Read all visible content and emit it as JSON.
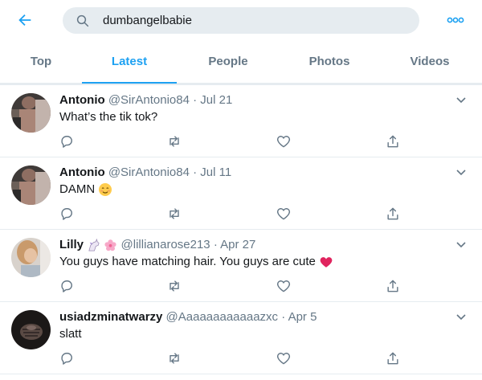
{
  "header": {
    "back_icon": "arrow-left-icon",
    "search_icon": "search-icon",
    "search_value": "dumbangelbabie",
    "more_icon": "more-horizontal-icon",
    "accent_color": "#1da1f2"
  },
  "tabs": [
    {
      "label": "Top",
      "active": false
    },
    {
      "label": "Latest",
      "active": true
    },
    {
      "label": "People",
      "active": false
    },
    {
      "label": "Photos",
      "active": false
    },
    {
      "label": "Videos",
      "active": false
    }
  ],
  "tweets": [
    {
      "name": "Antonio",
      "handle": "@SirAntonio84",
      "date": "Jul 21",
      "text": "What’s the tik tok?"
    },
    {
      "name": "Antonio",
      "handle": "@SirAntonio84",
      "date": "Jul 11",
      "text": "DAMN",
      "trailing_emoji": "smiling-blushing-face"
    },
    {
      "name": "Lilly",
      "name_emojis": [
        "unicorn",
        "cherry-blossom"
      ],
      "handle": "@lillianarose213",
      "date": "Apr 27",
      "text": "You guys have matching hair. You guys are cute",
      "trailing_emoji": "red-heart"
    },
    {
      "name": "usiadzminatwarzy",
      "handle": "@Aaaaaaaaaaaazxc",
      "date": "Apr 5",
      "text": "slatt"
    }
  ],
  "actions": {
    "reply_icon": "reply-icon",
    "retweet_icon": "retweet-icon",
    "like_icon": "heart-icon",
    "share_icon": "share-icon",
    "caret_icon": "chevron-down-icon"
  },
  "colors": {
    "text": "#14171a",
    "muted": "#657786",
    "border": "#e6ecf0",
    "search_bg": "#e6ecf0",
    "heart": "#e0245e"
  }
}
